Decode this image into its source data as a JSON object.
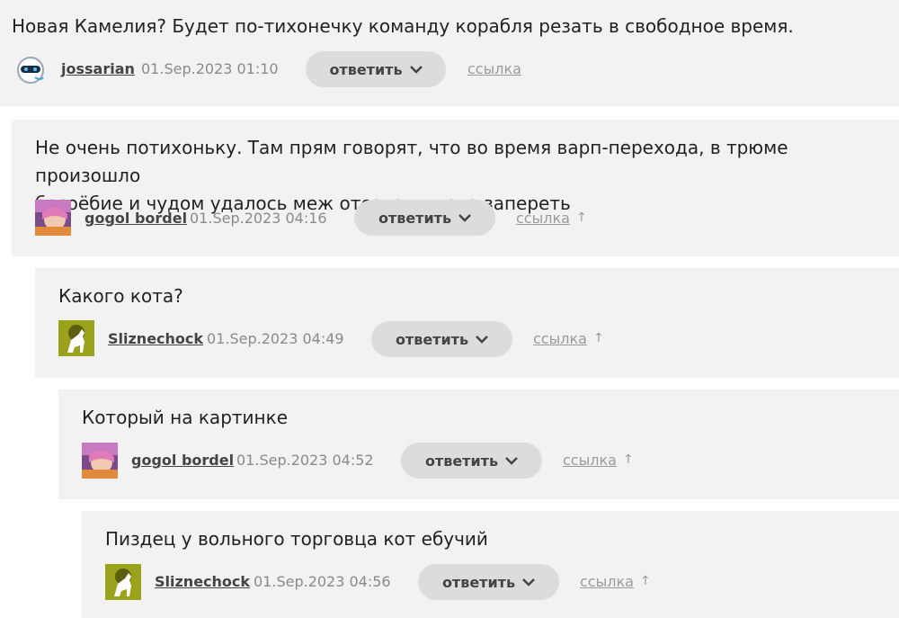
{
  "comments": [
    {
      "text": "Новая Камелия? Будет по-тихонечку команду корабля резать в свободное время.",
      "author": "jossarian",
      "date": "01.Sep.2023 01:10",
      "reply_label": "ответить",
      "link_label": "ссылка",
      "avatar": "robot-avatar-icon"
    },
    {
      "text": "Не очень потихоньку. Там прям говорят, что во время варп-перехода, в трюме произошло\nбесоёбие и чудом удалось меж отсеками кота запереть",
      "author": "gogol bordel",
      "date": "01.Sep.2023 04:16",
      "reply_label": "ответить",
      "link_label": "ссылка",
      "up_label": "↑",
      "avatar": "anime-avatar-icon"
    },
    {
      "text": "Какого кота?",
      "author": "Sliznechock",
      "date": "01.Sep.2023 04:49",
      "reply_label": "ответить",
      "link_label": "ссылка",
      "up_label": "↑",
      "avatar": "white-dog-avatar-icon"
    },
    {
      "text": "Который на картинке",
      "author": "gogol bordel",
      "date": "01.Sep.2023 04:52",
      "reply_label": "ответить",
      "link_label": "ссылка",
      "up_label": "↑",
      "avatar": "anime-avatar-icon"
    },
    {
      "text": "Пиздец у вольного торговца кот ебучий",
      "author": "Sliznechock",
      "date": "01.Sep.2023 04:56",
      "reply_label": "ответить",
      "link_label": "ссылка",
      "up_label": "↑",
      "avatar": "white-dog-avatar-icon"
    }
  ],
  "colors": {
    "card_bg": "#f2f2f2",
    "reply_bg": "#dcdcdc",
    "muted": "#9a9a9a"
  }
}
